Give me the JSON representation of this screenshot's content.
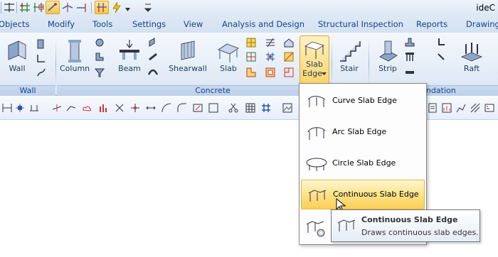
{
  "app": {
    "title": "ideC"
  },
  "tabs": [
    "Objects",
    "Modify",
    "Tools",
    "Settings",
    "View",
    "Analysis and Design",
    "Structural Inspection",
    "Reports",
    "Drawing"
  ],
  "ribbon": {
    "buttons": {
      "wall": "Wall",
      "column": "Column",
      "beam": "Beam",
      "shearwall": "Shearwall",
      "slab": "Slab",
      "slab_edge_line1": "Slab",
      "slab_edge_line2": "Edge",
      "stair": "Stair",
      "strip": "Strip",
      "raft": "Raft"
    },
    "groups": {
      "wall": "Wall",
      "concrete": "Concrete",
      "foundation": "Foundation"
    }
  },
  "dropdown": {
    "items": [
      {
        "label": "Curve Slab Edge",
        "icon": "curve-slab-edge-icon"
      },
      {
        "label": "Arc Slab Edge",
        "icon": "arc-slab-edge-icon"
      },
      {
        "label": "Circle Slab Edge",
        "icon": "circle-slab-edge-icon"
      },
      {
        "label": "Continuous Slab Edge",
        "icon": "continuous-slab-edge-icon"
      }
    ],
    "highlighted": "Continuous Slab Edge"
  },
  "tooltip": {
    "title": "Continuous Slab Edge",
    "description": "Draws continuous slab edges."
  },
  "colors": {
    "accent": "#fcd46a",
    "ribbon_text": "#15428b"
  }
}
